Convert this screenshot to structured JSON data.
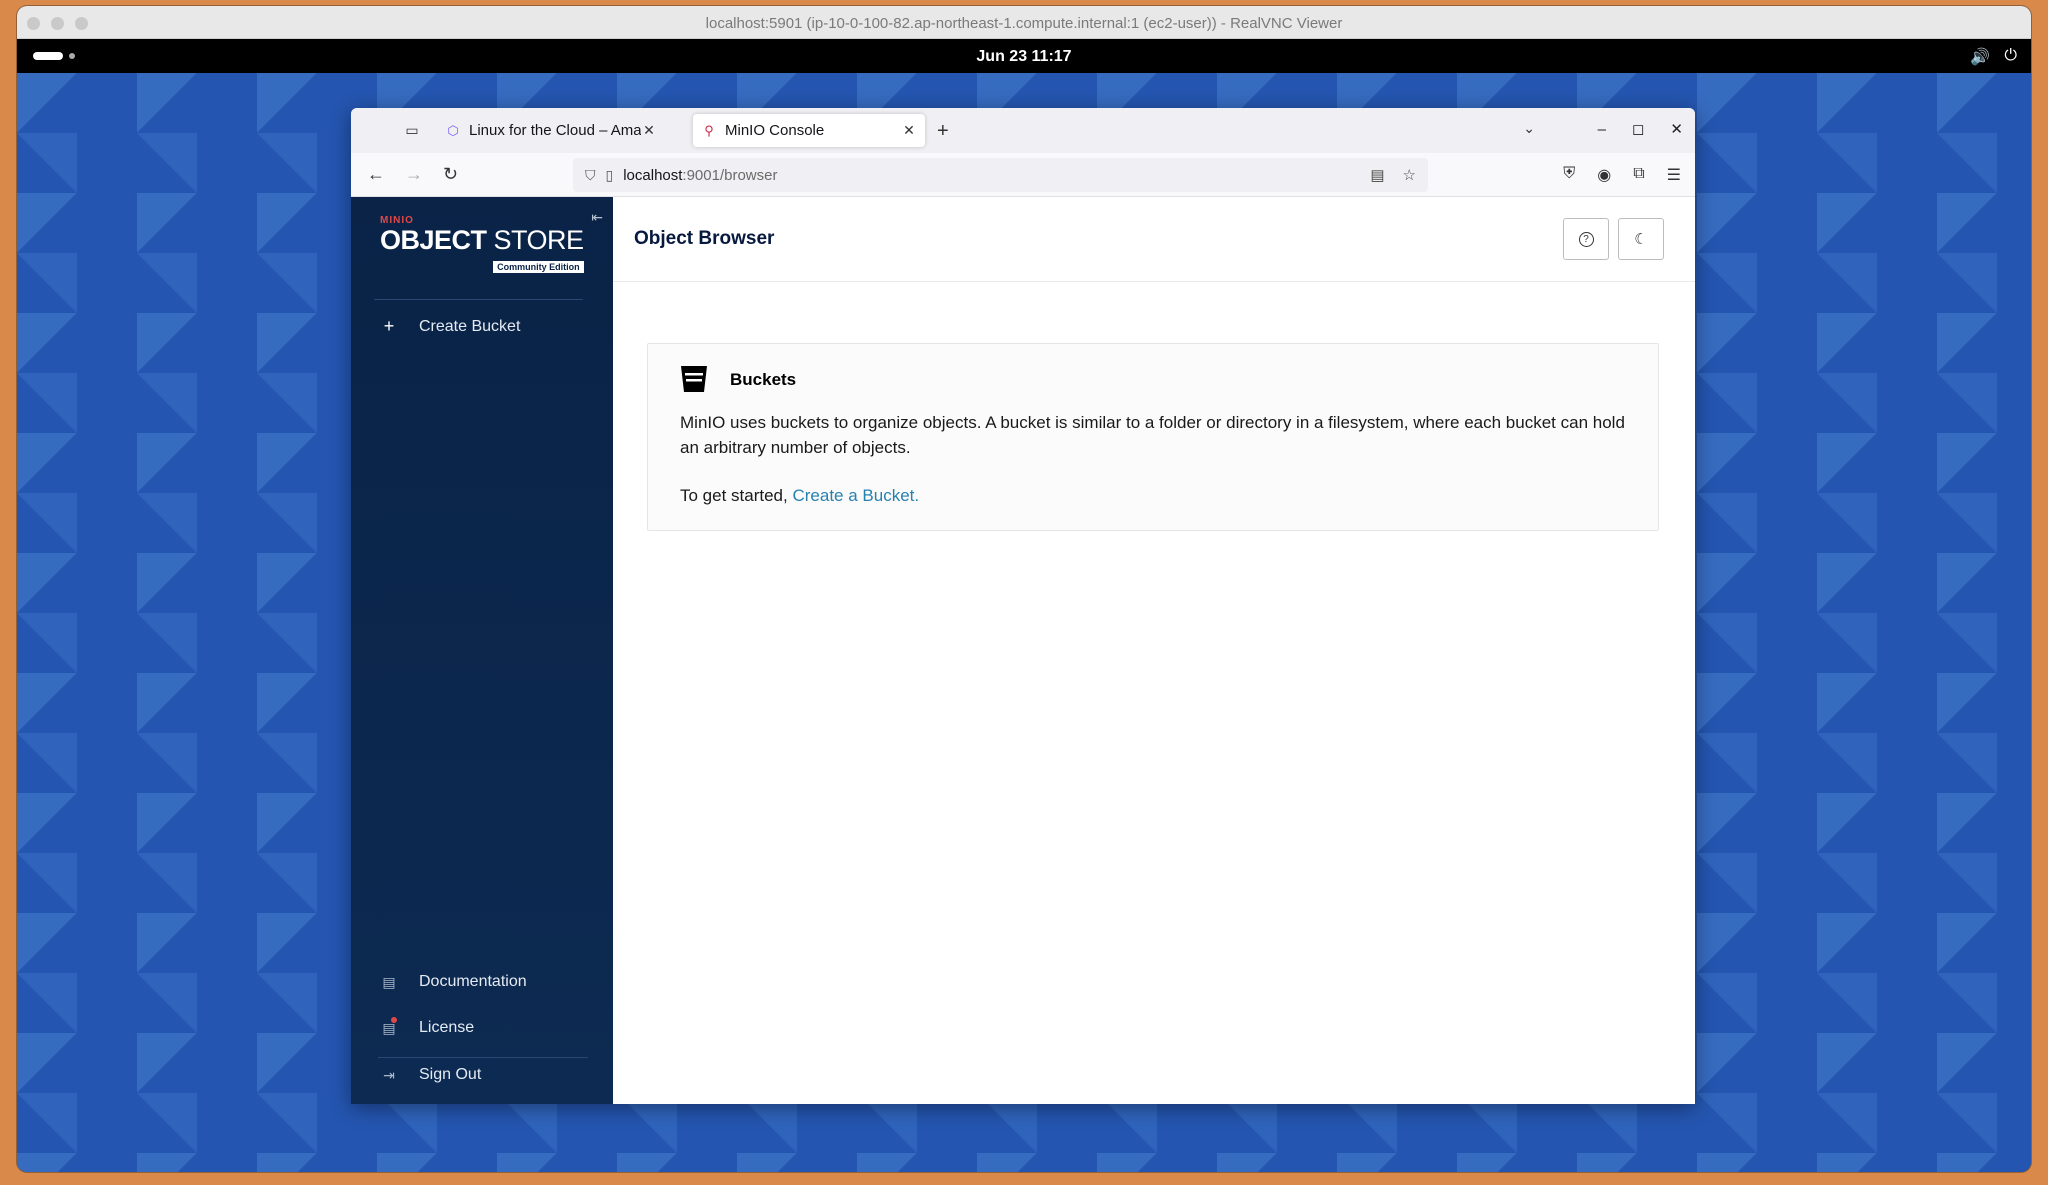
{
  "vnc": {
    "title": "localhost:5901 (ip-10-0-100-82.ap-northeast-1.compute.internal:1 (ec2-user)) - RealVNC Viewer"
  },
  "gnome": {
    "clock": "Jun 23  11:17",
    "tray_icons": [
      "volume-icon",
      "power-icon"
    ]
  },
  "browser": {
    "tabs": [
      {
        "label": "Linux for the Cloud – Ama",
        "icon": "cube-icon",
        "active": false
      },
      {
        "label": "MinIO Console",
        "icon": "minio-icon",
        "active": true
      }
    ],
    "url_host": "localhost",
    "url_path": ":9001/browser"
  },
  "minio": {
    "brand": "MINIO",
    "logo_object": "OBJECT",
    "logo_store": "STORE",
    "edition": "Community Edition",
    "sidebar": {
      "create_bucket": "Create Bucket",
      "documentation": "Documentation",
      "license": "License",
      "sign_out": "Sign Out"
    },
    "header": {
      "title": "Object Browser"
    },
    "card": {
      "title": "Buckets",
      "description": "MinIO uses buckets to organize objects. A bucket is similar to a folder or directory in a filesystem, where each bucket can hold an arbitrary number of objects.",
      "start_prefix": "To get started,",
      "start_link": "Create a Bucket."
    }
  }
}
